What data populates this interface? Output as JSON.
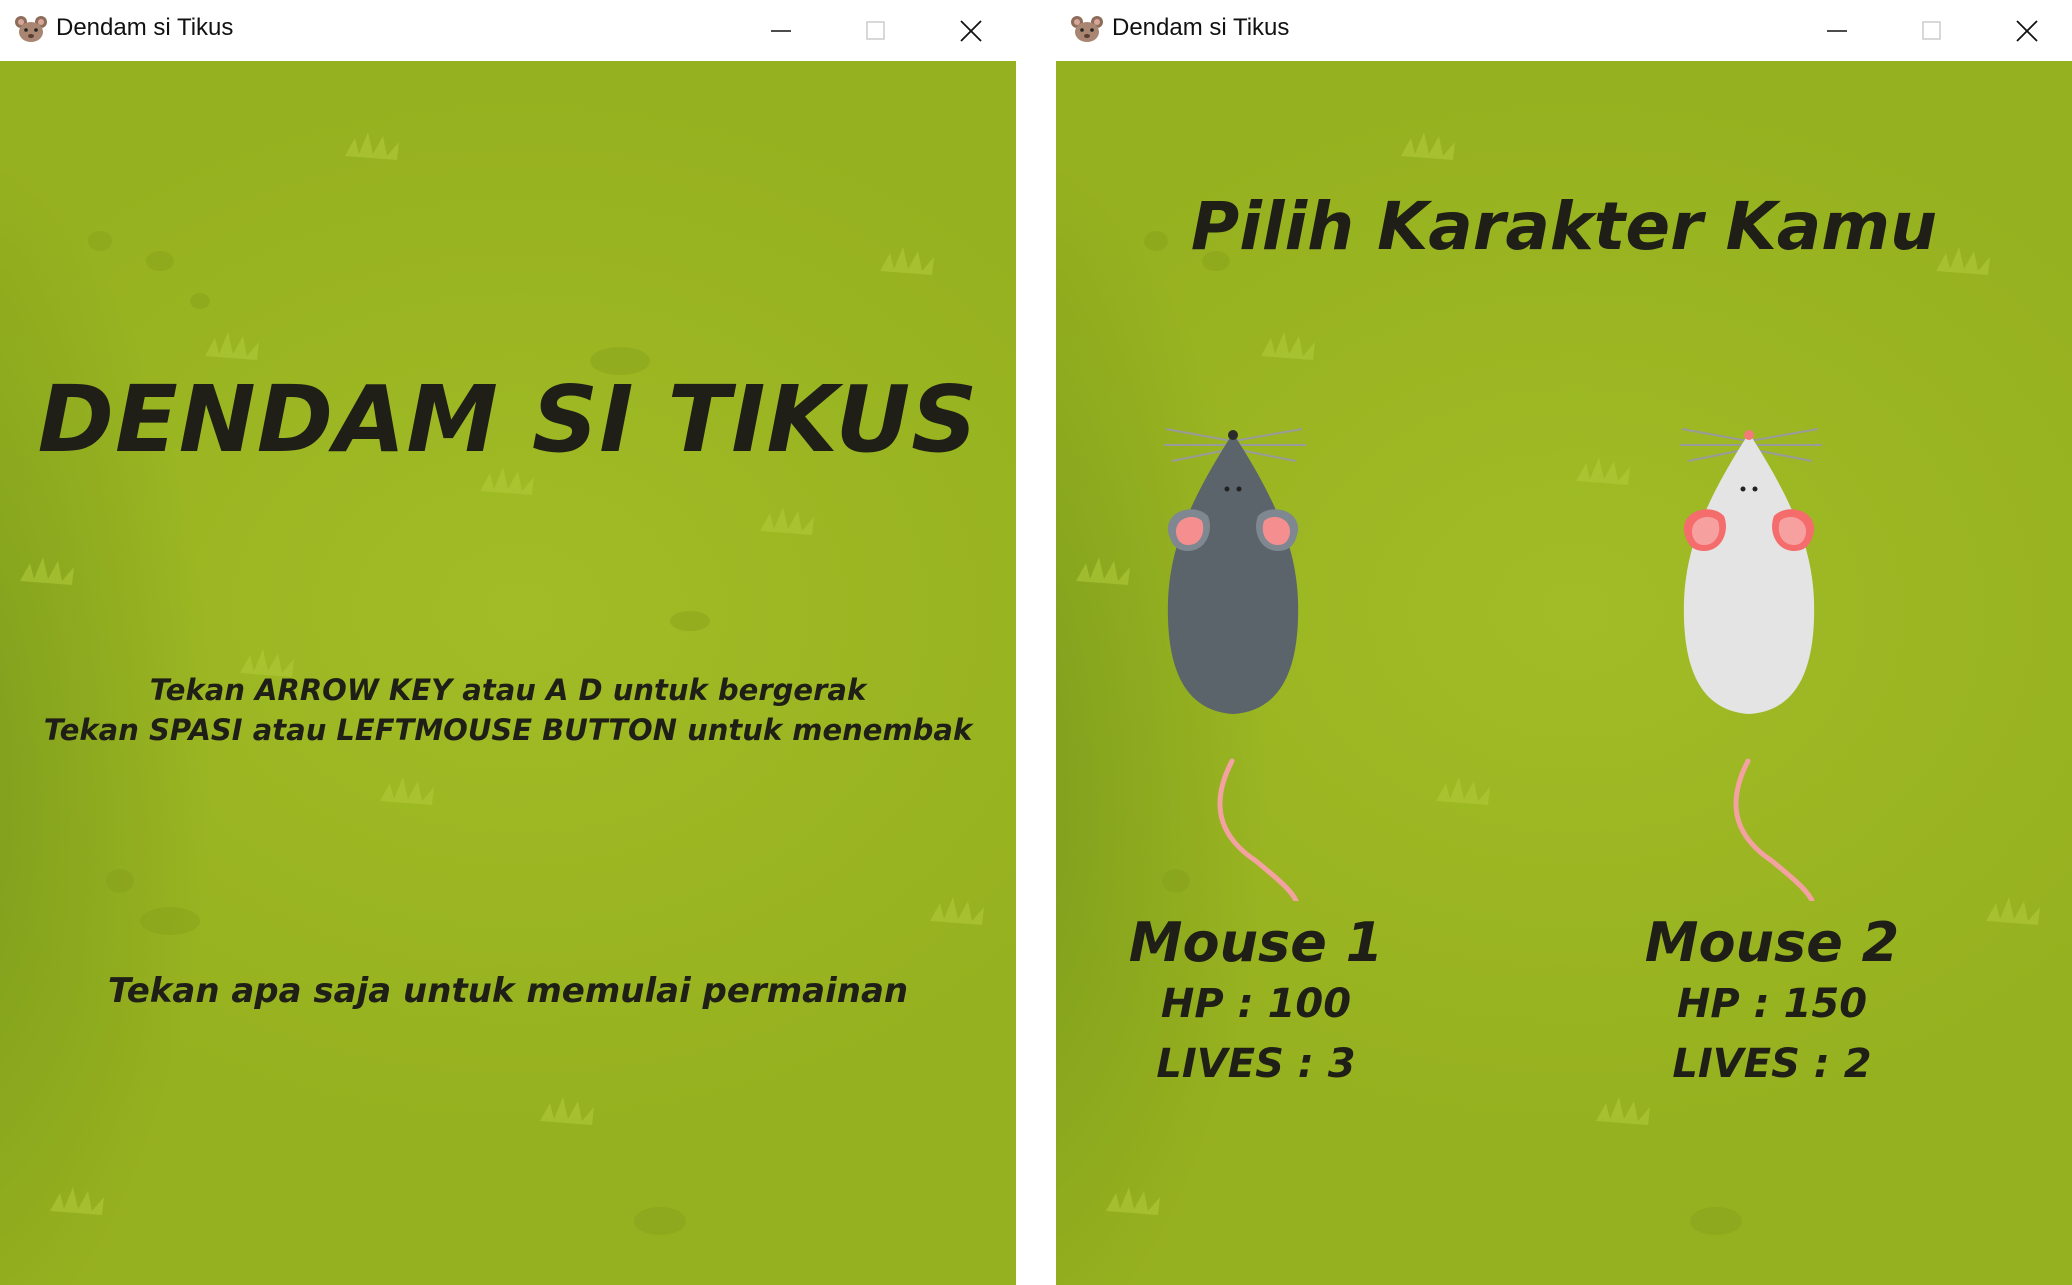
{
  "windows": [
    {
      "title": "Dendam si Tikus",
      "screen": {
        "game_title": "DENDAM SI TIKUS",
        "instruction_move": "Tekan ARROW KEY atau A D untuk bergerak",
        "instruction_shoot": "Tekan SPASI atau LEFTMOUSE BUTTON untuk menembak",
        "start_prompt": "Tekan apa saja untuk memulai permainan"
      }
    },
    {
      "title": "Dendam si Tikus",
      "screen": {
        "heading": "Pilih Karakter Kamu",
        "characters": [
          {
            "name": "Mouse 1",
            "hp": "HP : 100",
            "lives": "LIVES : 3",
            "body_color": "#5b636b"
          },
          {
            "name": "Mouse 2",
            "hp": "HP : 150",
            "lives": "LIVES : 2",
            "body_color": "#e4e4e4"
          }
        ]
      }
    }
  ],
  "icons": {
    "app": "mouse-face-icon",
    "minimize": "minimize-icon",
    "maximize": "maximize-icon",
    "close": "close-icon"
  },
  "colors": {
    "grass": "#9cb722",
    "text": "#1f1f17",
    "ear": "#f58f8f",
    "tail": "#f6a3a3"
  }
}
